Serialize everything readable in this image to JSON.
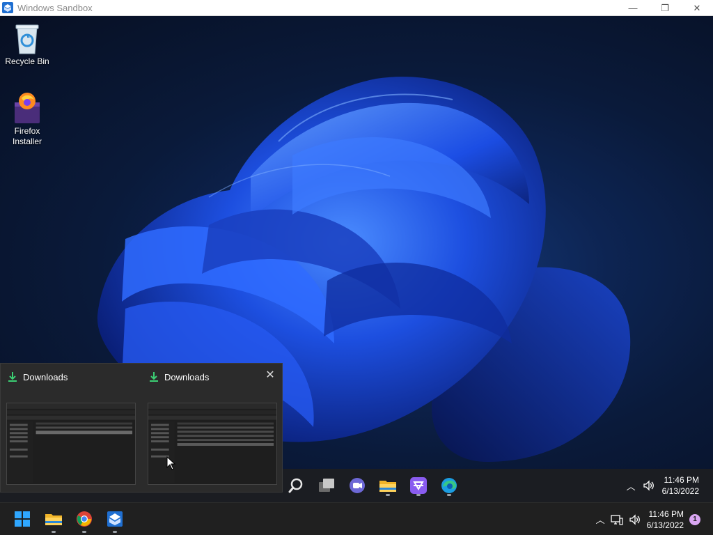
{
  "window": {
    "title": "Windows Sandbox",
    "controls": {
      "minimize": "—",
      "maximize": "❐",
      "close": "✕"
    }
  },
  "desktop": {
    "icons": [
      {
        "label": "Recycle Bin",
        "icon": "recycle-bin-icon"
      },
      {
        "label": "Firefox\nInstaller",
        "icon": "firefox-installer-icon"
      }
    ]
  },
  "previews": {
    "items": [
      {
        "title": "Downloads",
        "icon": "download-icon"
      },
      {
        "title": "Downloads",
        "icon": "download-icon",
        "close": "✕"
      }
    ]
  },
  "inner_taskbar": {
    "apps": [
      "search-icon",
      "task-view-icon",
      "teams-chat-icon",
      "file-explorer-icon",
      "devhome-icon",
      "edge-icon"
    ],
    "time": "11:46 PM",
    "date": "6/13/2022"
  },
  "host_taskbar": {
    "apps": [
      "start-icon",
      "file-explorer-icon",
      "chrome-icon",
      "windows-sandbox-icon"
    ],
    "time": "11:46 PM",
    "date": "6/13/2022",
    "notification_count": "1"
  },
  "colors": {
    "accent": "#0078d4",
    "wallpaper_blue": "#1e5bff",
    "taskbar": "#1b1d22"
  }
}
